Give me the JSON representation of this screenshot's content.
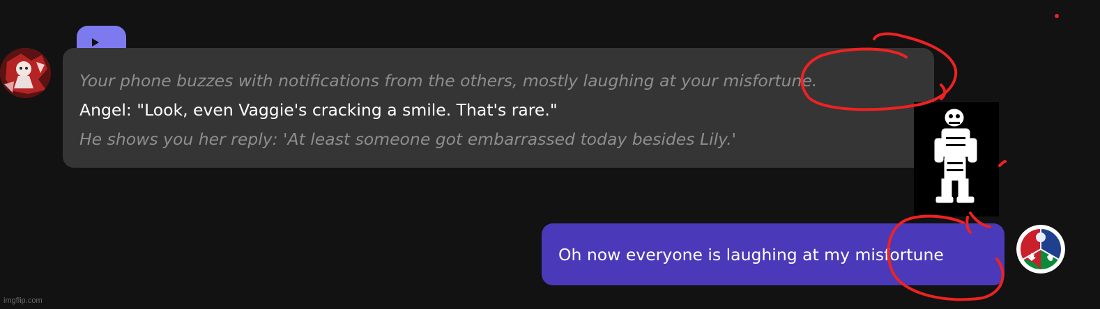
{
  "chat": {
    "bot_message": {
      "play_label": "play",
      "lines": [
        {
          "type": "narration",
          "text": "Your phone buzzes with notifications from the others, mostly laughing at your misfortune."
        },
        {
          "type": "speech",
          "text": "Angel: \"Look, even Vaggie's cracking a smile. That's rare.\""
        },
        {
          "type": "narration",
          "text": "He shows you her reply: 'At least someone got embarrassed today besides Lily.'"
        }
      ]
    },
    "user_message": {
      "text": "Oh now everyone is laughing at my misfortune"
    }
  },
  "watermark": "imgflip.com",
  "colors": {
    "background": "#121212",
    "bot_bubble": "#353535",
    "user_bubble": "#4a3ab9",
    "play_button": "#7d79ef",
    "annotation": "#ee2222"
  },
  "icons": {
    "play": "play-icon",
    "bot_avatar": "bot-avatar",
    "user_avatar": "user-avatar",
    "character": "skeleton-character-image"
  }
}
